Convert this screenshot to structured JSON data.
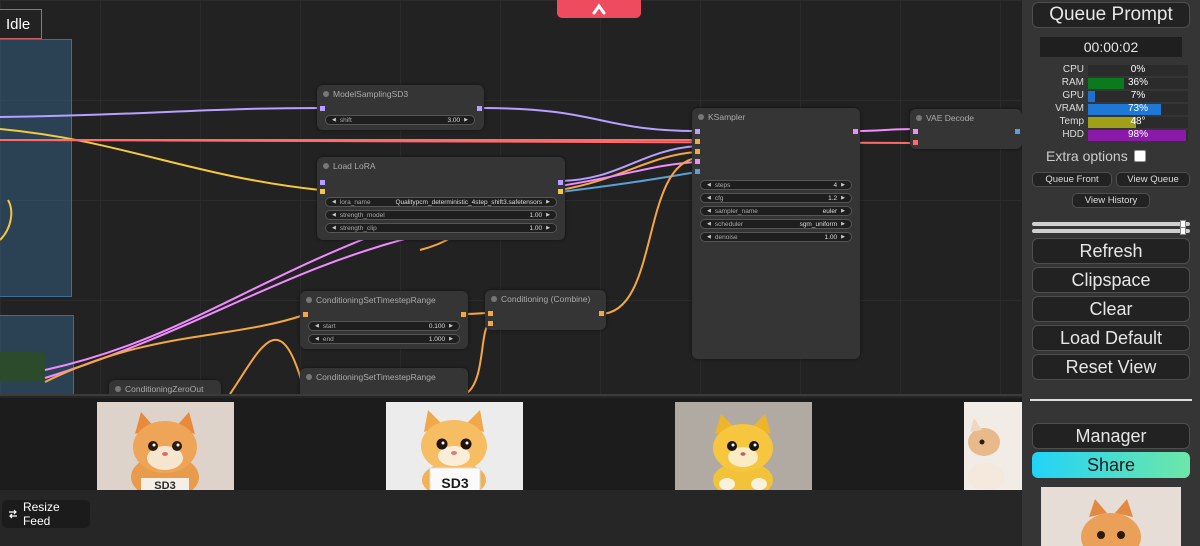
{
  "status": {
    "label": "Idle"
  },
  "nodes": {
    "model_sampling": {
      "title": "ModelSamplingSD3",
      "shift_label": "shift",
      "shift_value": "3.00"
    },
    "load_lora": {
      "title": "Load LoRA",
      "lora_name_label": "lora_name",
      "lora_name_value": "Qualitypcm_deterministic_4step_shift3.safetensors",
      "strength_model_label": "strength_model",
      "strength_model_value": "1.00",
      "strength_clip_label": "strength_clip",
      "strength_clip_value": "1.00"
    },
    "ksampler": {
      "title": "KSampler",
      "steps_label": "steps",
      "steps_value": "4",
      "cfg_label": "cfg",
      "cfg_value": "1.2",
      "sampler_label": "sampler_name",
      "sampler_value": "euler",
      "scheduler_label": "scheduler",
      "scheduler_value": "sgm_uniform",
      "denoise_label": "denoise",
      "denoise_value": "1.00"
    },
    "vae_decode": {
      "title": "VAE Decode"
    },
    "cond_range_1": {
      "title": "ConditioningSetTimestepRange",
      "start_label": "start",
      "start_value": "0.100",
      "end_label": "end",
      "end_value": "1.000"
    },
    "cond_range_2": {
      "title": "ConditioningSetTimestepRange"
    },
    "cond_combine": {
      "title": "Conditioning (Combine)"
    },
    "cond_zero": {
      "title": "ConditioningZeroOut"
    }
  },
  "feed": {
    "resize_label": "Resize Feed",
    "thumbs": [
      {
        "sign": "SD3"
      },
      {
        "sign": "SD3"
      },
      {
        "sign": ""
      },
      {
        "sign": ""
      }
    ]
  },
  "panel": {
    "queue_prompt": "Queue Prompt",
    "timer": "00:00:02",
    "monitors": [
      {
        "label": "CPU",
        "value": "0%",
        "fill": 0.0,
        "color": "#0a7a24"
      },
      {
        "label": "RAM",
        "value": "36%",
        "fill": 0.36,
        "color": "#0b7a1f"
      },
      {
        "label": "GPU",
        "value": "7%",
        "fill": 0.07,
        "color": "#1f6fcf"
      },
      {
        "label": "VRAM",
        "value": "73%",
        "fill": 0.73,
        "color": "#1f78d6"
      },
      {
        "label": "Temp",
        "value": "48°",
        "fill": 0.48,
        "color": "#a0a018"
      },
      {
        "label": "HDD",
        "value": "98%",
        "fill": 0.98,
        "color": "#8a1aa8"
      }
    ],
    "extra_options": "Extra options",
    "queue_front": "Queue Front",
    "view_queue": "View Queue",
    "view_history": "View History",
    "refresh": "Refresh",
    "clipspace": "Clipspace",
    "clear": "Clear",
    "load_default": "Load Default",
    "reset_view": "Reset View",
    "manager": "Manager",
    "share": "Share"
  }
}
